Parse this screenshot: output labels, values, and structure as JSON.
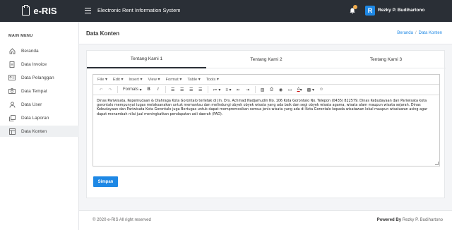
{
  "topbar": {
    "brand": "e-RIS",
    "app_title": "Electronic Rent Information System",
    "user_initial": "R",
    "user_name": "Rezky P. Budihartono",
    "accent": "#1e88e5"
  },
  "sidebar": {
    "title": "MAIN MENU",
    "items": [
      {
        "label": "Beranda",
        "icon": "home-icon"
      },
      {
        "label": "Data Invoice",
        "icon": "invoice-icon"
      },
      {
        "label": "Data Pelanggan",
        "icon": "id-card-icon"
      },
      {
        "label": "Data Tempat",
        "icon": "camera-icon"
      },
      {
        "label": "Data User",
        "icon": "user-icon"
      },
      {
        "label": "Data Laporan",
        "icon": "copy-icon"
      },
      {
        "label": "Data Konten",
        "icon": "layout-icon"
      }
    ]
  },
  "header": {
    "page_title": "Data Konten",
    "breadcrumb": [
      "Beranda",
      "Data Konten"
    ]
  },
  "tabs": [
    "Tentang Kami 1",
    "Tentang Kami 2",
    "Tentang Kami 3"
  ],
  "editor": {
    "menus": [
      "File",
      "Edit",
      "Insert",
      "View",
      "Format",
      "Table",
      "Tools"
    ],
    "formats_label": "Formats",
    "content": "Dinas Pariwisata, Kepemudaan & Olahraga Kota Gorontalo terletak di Jln. Drs. Achmad Nadjamudin No. 106 Kota Gorontalo No. Telepon (0435) 822579. Dinas Kebudayaan dan Pariwisata kota gorontalo mempunyai tugas melaksanakan untuk memantau dan melindungi obyek obyek wisata yang ada baik dan segi obyek wisata agama, wisata alam maupun wisata sejarah. Dinas Kebudayaan dan Pariwisata Kota Gorontalo juga Bertugas untuk dapat mempromosikan semua jenis wisata yang ada di Kota Gorontalo kepada wisatawan lokal maupun wisatawan asing agar dapat menambah nilai jual meningkatkan pendapatan asli daerah (PAD)."
  },
  "save_label": "Simpan",
  "footer": {
    "copyright": "© 2020 e-RIS All right reserved",
    "powered_by": "Powered By",
    "author": "Rezky P. Budihartono"
  }
}
